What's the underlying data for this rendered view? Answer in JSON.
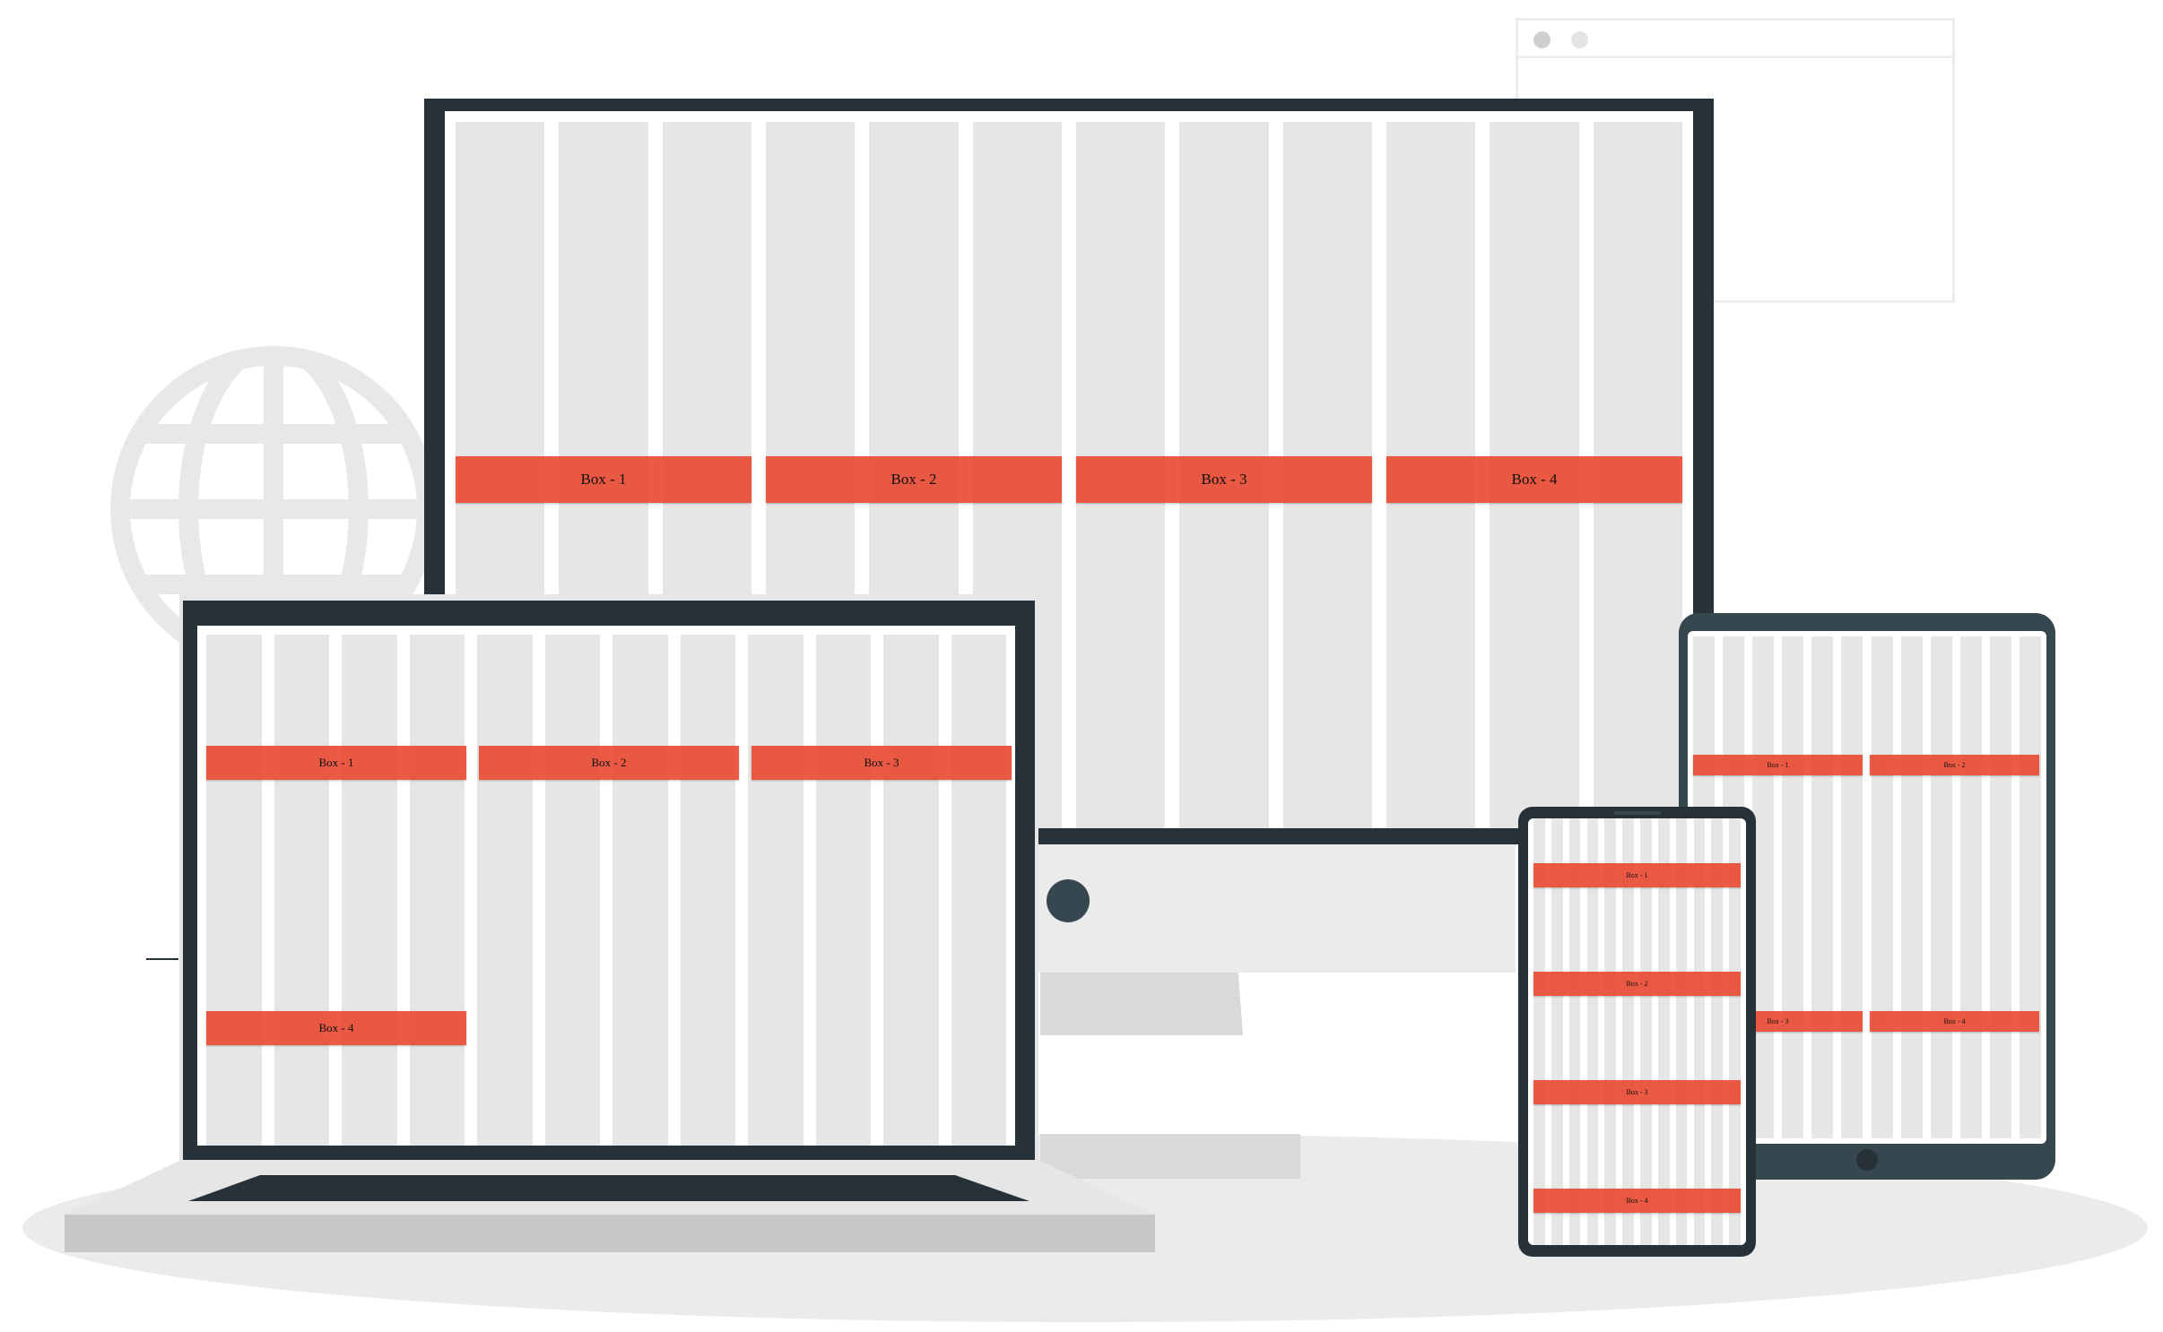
{
  "illustration": {
    "monitor": {
      "boxes": [
        "Box - 1",
        "Box - 2",
        "Box - 3",
        "Box - 4"
      ],
      "columns": 12,
      "boxes_per_row": 4
    },
    "laptop": {
      "boxes": [
        "Box - 1",
        "Box - 2",
        "Box - 3",
        "Box - 4"
      ],
      "columns": 12,
      "boxes_per_row": 3
    },
    "tablet": {
      "boxes": [
        "Box - 1",
        "Box - 2",
        "Box - 3",
        "Box - 4"
      ],
      "columns": 12,
      "boxes_per_row": 2
    },
    "phone": {
      "boxes": [
        "Box - 1",
        "Box - 2",
        "Box - 3",
        "Box - 4"
      ],
      "columns": 12,
      "boxes_per_row": 1
    }
  },
  "colors": {
    "frame_dark": "#263238",
    "box_accent": "#e84830",
    "grid_column": "#e6e6e6",
    "floor": "#ebebeb",
    "stand": "#d9d9d9"
  },
  "icons": [
    "globe-icon",
    "browser-window-icon",
    "monitor-camera-icon",
    "tablet-home-button-icon",
    "phone-speaker-icon"
  ]
}
